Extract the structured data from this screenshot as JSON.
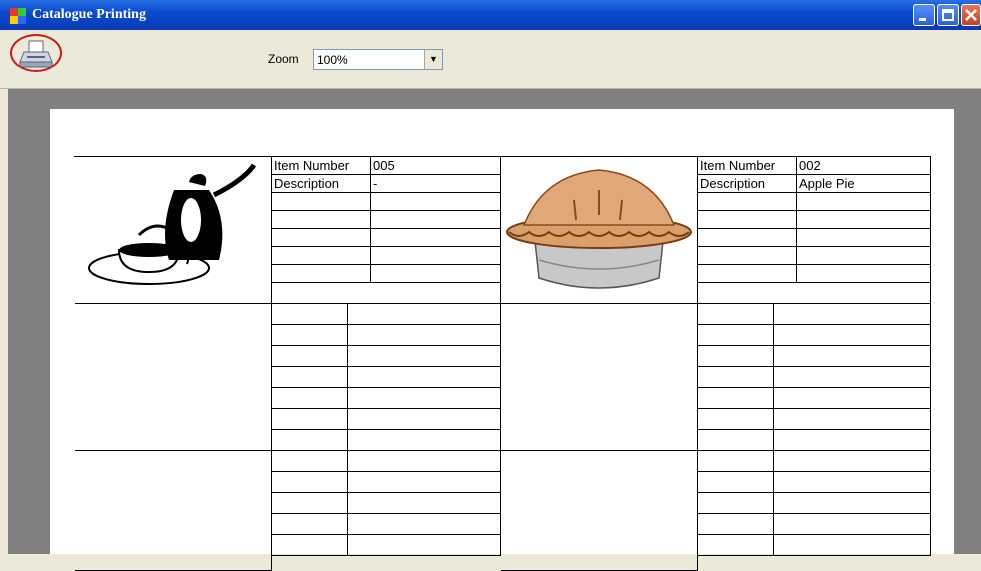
{
  "window": {
    "title": "Catalogue Printing",
    "title_icon": "app-icon",
    "buttons": [
      "minimize",
      "maximize",
      "close"
    ]
  },
  "toolbar": {
    "print_icon": "printer-icon",
    "zoom_label": "Zoom",
    "zoom_value": "100%"
  },
  "catalogue": {
    "items": [
      {
        "item_number_label": "Item Number",
        "item_number": "005",
        "description_label": "Description",
        "description": "-",
        "image": "coffee-pot-and-cup-image"
      },
      {
        "item_number_label": "Item Number",
        "item_number": "002",
        "description_label": "Description",
        "description": "Apple Pie",
        "image": "apple-pie-image"
      }
    ]
  },
  "colors": {
    "titlebar": "#0a4ccf",
    "highlight_ring": "#d0151b",
    "preview_background": "#808080"
  }
}
